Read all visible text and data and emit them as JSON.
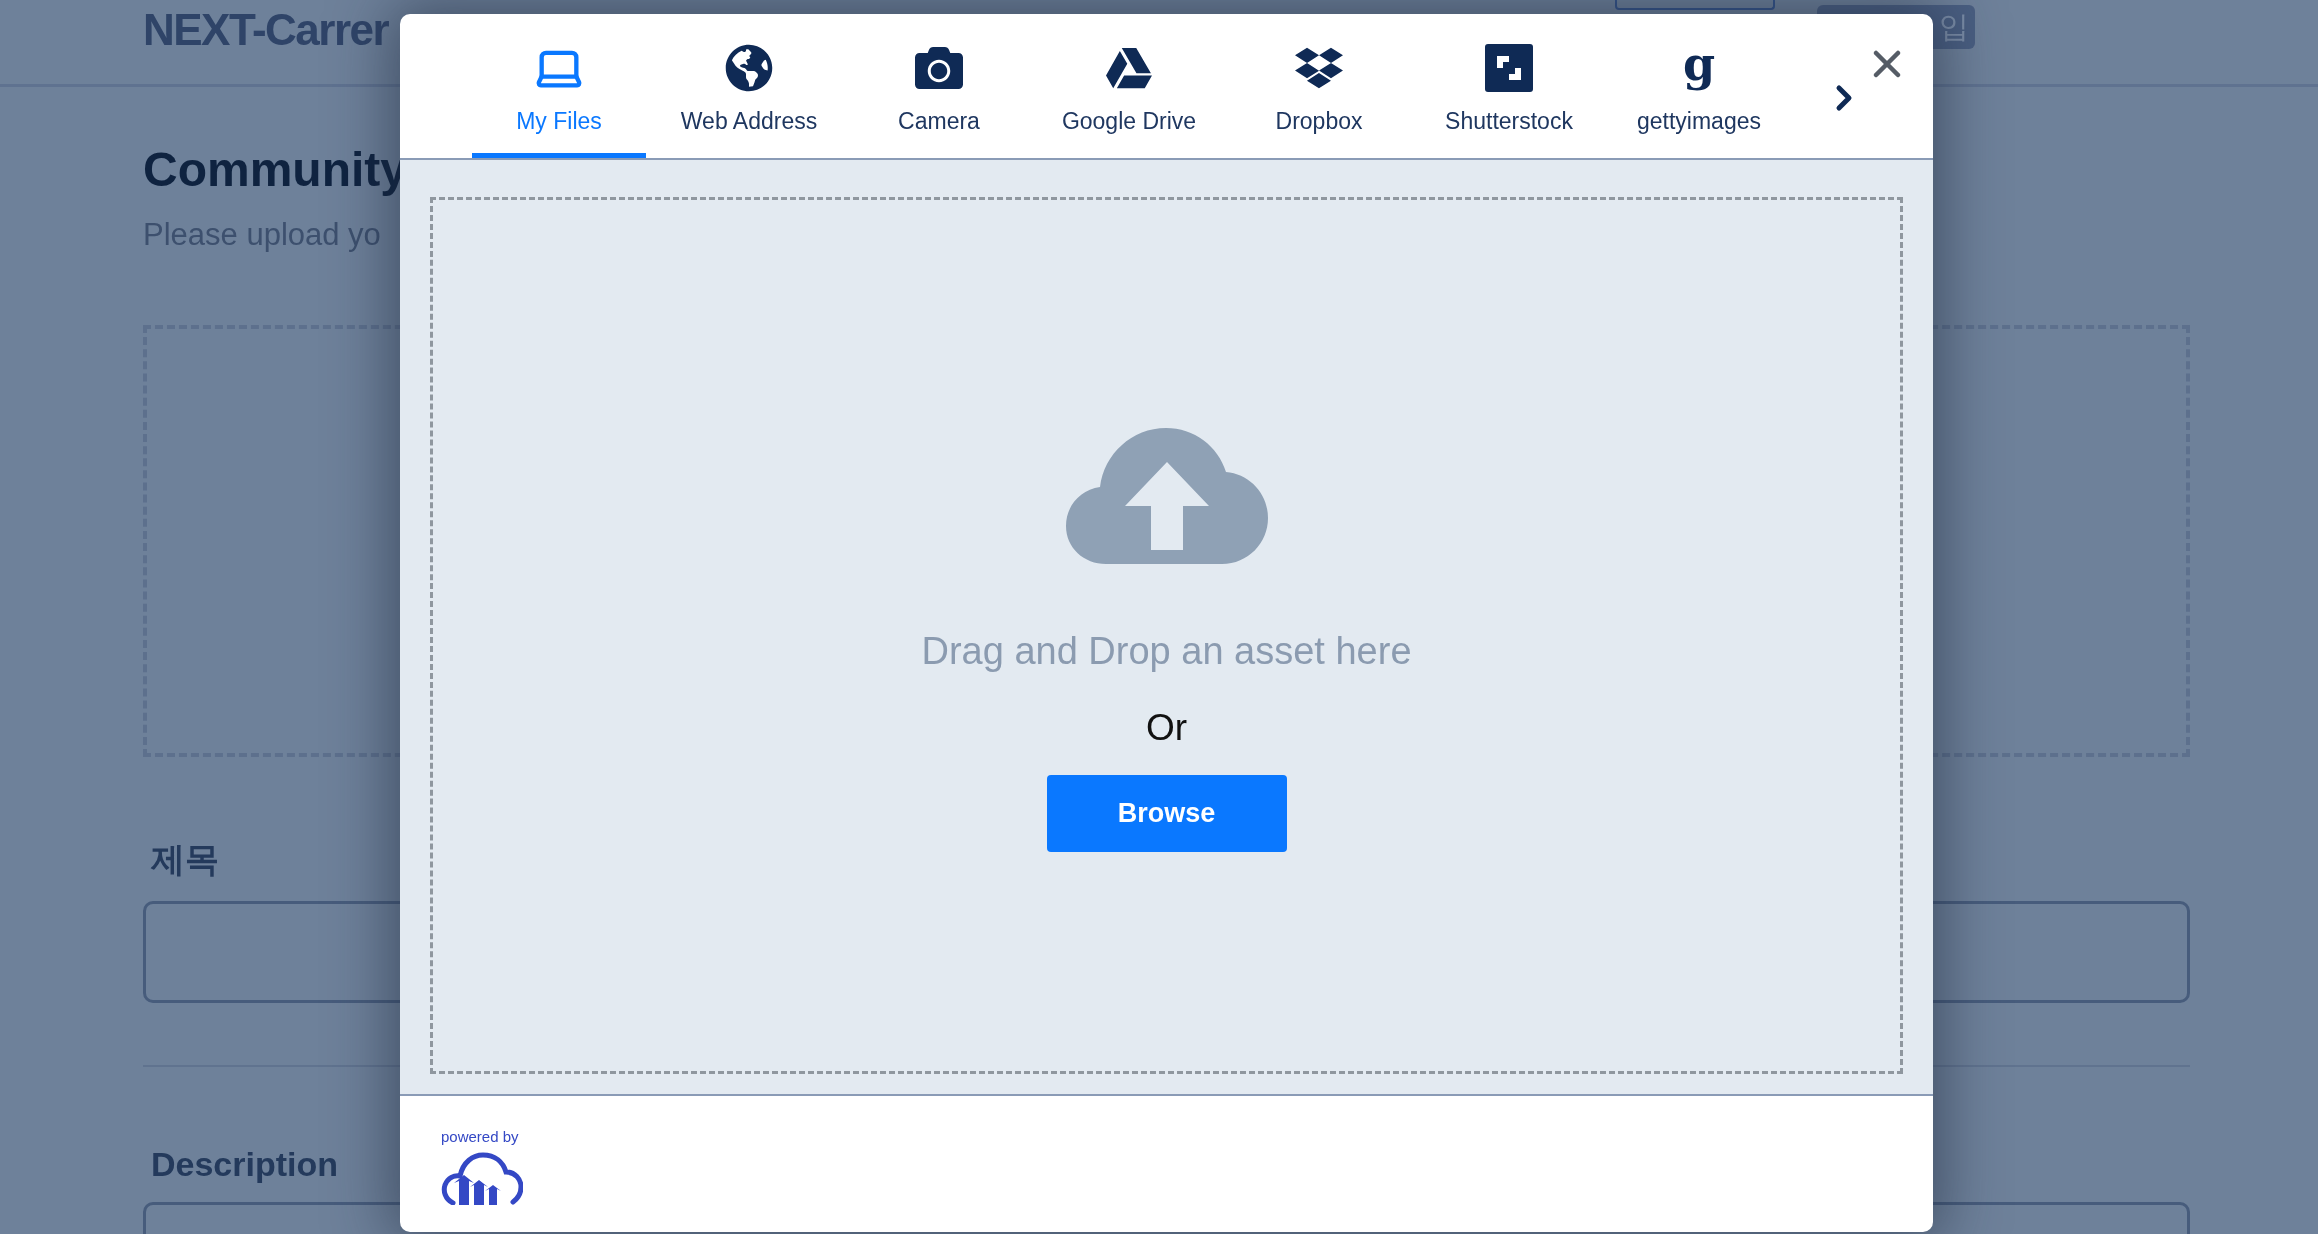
{
  "background_page": {
    "site_title": "NEXT-Carrer",
    "header_button_text": "입",
    "heading": "Community",
    "subtitle": "Please upload yo",
    "title_label": "제목",
    "description_label": "Description"
  },
  "modal": {
    "tabs": [
      {
        "label": "My Files",
        "kind": "laptop",
        "selected": true
      },
      {
        "label": "Web Address",
        "kind": "globe",
        "selected": false
      },
      {
        "label": "Camera",
        "kind": "camera",
        "selected": false
      },
      {
        "label": "Google Drive",
        "kind": "drive",
        "selected": false
      },
      {
        "label": "Dropbox",
        "kind": "dropbox",
        "selected": false
      },
      {
        "label": "Shutterstock",
        "kind": "shutterstock",
        "selected": false
      },
      {
        "label": "gettyimages",
        "kind": "letter",
        "glyph": "g",
        "selected": false
      }
    ],
    "drop_text": "Drag and Drop an asset here",
    "or_text": "Or",
    "browse_button": "Browse",
    "powered_by": "powered by"
  }
}
